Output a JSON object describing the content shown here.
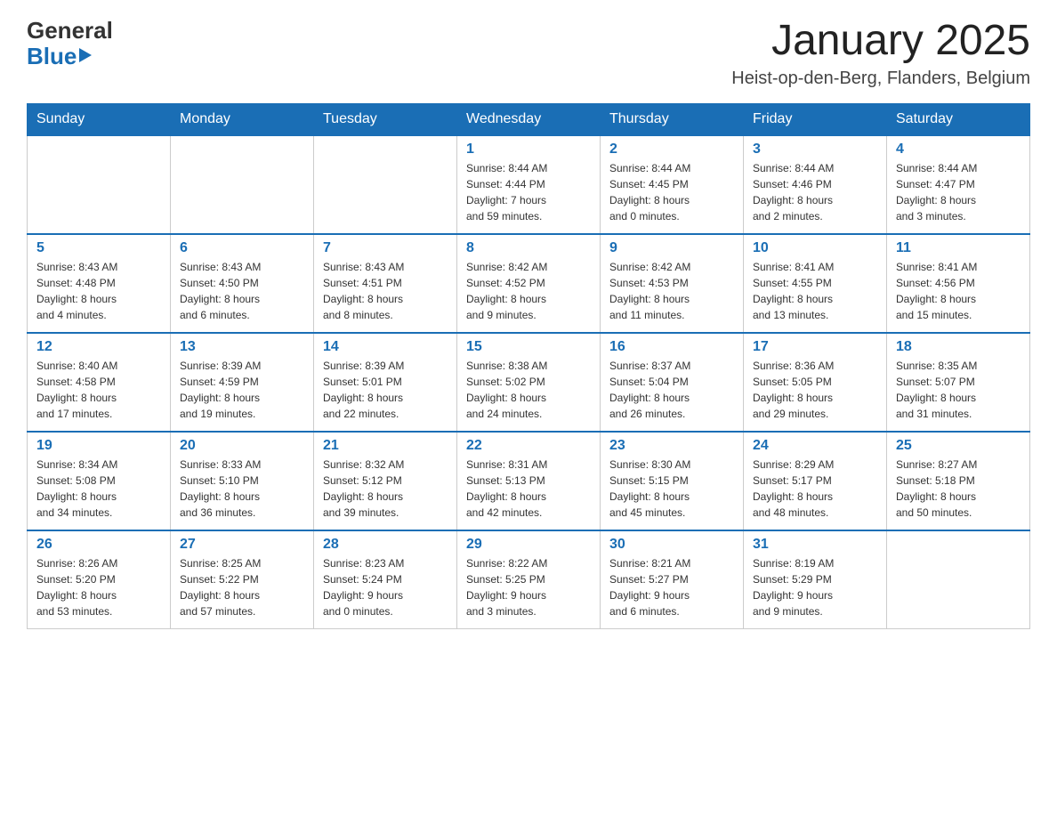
{
  "header": {
    "logo": {
      "general": "General",
      "blue": "Blue"
    },
    "title": "January 2025",
    "location": "Heist-op-den-Berg, Flanders, Belgium"
  },
  "days_of_week": [
    "Sunday",
    "Monday",
    "Tuesday",
    "Wednesday",
    "Thursday",
    "Friday",
    "Saturday"
  ],
  "weeks": [
    {
      "days": [
        {
          "date": "",
          "info": ""
        },
        {
          "date": "",
          "info": ""
        },
        {
          "date": "",
          "info": ""
        },
        {
          "date": "1",
          "info": "Sunrise: 8:44 AM\nSunset: 4:44 PM\nDaylight: 7 hours\nand 59 minutes."
        },
        {
          "date": "2",
          "info": "Sunrise: 8:44 AM\nSunset: 4:45 PM\nDaylight: 8 hours\nand 0 minutes."
        },
        {
          "date": "3",
          "info": "Sunrise: 8:44 AM\nSunset: 4:46 PM\nDaylight: 8 hours\nand 2 minutes."
        },
        {
          "date": "4",
          "info": "Sunrise: 8:44 AM\nSunset: 4:47 PM\nDaylight: 8 hours\nand 3 minutes."
        }
      ]
    },
    {
      "days": [
        {
          "date": "5",
          "info": "Sunrise: 8:43 AM\nSunset: 4:48 PM\nDaylight: 8 hours\nand 4 minutes."
        },
        {
          "date": "6",
          "info": "Sunrise: 8:43 AM\nSunset: 4:50 PM\nDaylight: 8 hours\nand 6 minutes."
        },
        {
          "date": "7",
          "info": "Sunrise: 8:43 AM\nSunset: 4:51 PM\nDaylight: 8 hours\nand 8 minutes."
        },
        {
          "date": "8",
          "info": "Sunrise: 8:42 AM\nSunset: 4:52 PM\nDaylight: 8 hours\nand 9 minutes."
        },
        {
          "date": "9",
          "info": "Sunrise: 8:42 AM\nSunset: 4:53 PM\nDaylight: 8 hours\nand 11 minutes."
        },
        {
          "date": "10",
          "info": "Sunrise: 8:41 AM\nSunset: 4:55 PM\nDaylight: 8 hours\nand 13 minutes."
        },
        {
          "date": "11",
          "info": "Sunrise: 8:41 AM\nSunset: 4:56 PM\nDaylight: 8 hours\nand 15 minutes."
        }
      ]
    },
    {
      "days": [
        {
          "date": "12",
          "info": "Sunrise: 8:40 AM\nSunset: 4:58 PM\nDaylight: 8 hours\nand 17 minutes."
        },
        {
          "date": "13",
          "info": "Sunrise: 8:39 AM\nSunset: 4:59 PM\nDaylight: 8 hours\nand 19 minutes."
        },
        {
          "date": "14",
          "info": "Sunrise: 8:39 AM\nSunset: 5:01 PM\nDaylight: 8 hours\nand 22 minutes."
        },
        {
          "date": "15",
          "info": "Sunrise: 8:38 AM\nSunset: 5:02 PM\nDaylight: 8 hours\nand 24 minutes."
        },
        {
          "date": "16",
          "info": "Sunrise: 8:37 AM\nSunset: 5:04 PM\nDaylight: 8 hours\nand 26 minutes."
        },
        {
          "date": "17",
          "info": "Sunrise: 8:36 AM\nSunset: 5:05 PM\nDaylight: 8 hours\nand 29 minutes."
        },
        {
          "date": "18",
          "info": "Sunrise: 8:35 AM\nSunset: 5:07 PM\nDaylight: 8 hours\nand 31 minutes."
        }
      ]
    },
    {
      "days": [
        {
          "date": "19",
          "info": "Sunrise: 8:34 AM\nSunset: 5:08 PM\nDaylight: 8 hours\nand 34 minutes."
        },
        {
          "date": "20",
          "info": "Sunrise: 8:33 AM\nSunset: 5:10 PM\nDaylight: 8 hours\nand 36 minutes."
        },
        {
          "date": "21",
          "info": "Sunrise: 8:32 AM\nSunset: 5:12 PM\nDaylight: 8 hours\nand 39 minutes."
        },
        {
          "date": "22",
          "info": "Sunrise: 8:31 AM\nSunset: 5:13 PM\nDaylight: 8 hours\nand 42 minutes."
        },
        {
          "date": "23",
          "info": "Sunrise: 8:30 AM\nSunset: 5:15 PM\nDaylight: 8 hours\nand 45 minutes."
        },
        {
          "date": "24",
          "info": "Sunrise: 8:29 AM\nSunset: 5:17 PM\nDaylight: 8 hours\nand 48 minutes."
        },
        {
          "date": "25",
          "info": "Sunrise: 8:27 AM\nSunset: 5:18 PM\nDaylight: 8 hours\nand 50 minutes."
        }
      ]
    },
    {
      "days": [
        {
          "date": "26",
          "info": "Sunrise: 8:26 AM\nSunset: 5:20 PM\nDaylight: 8 hours\nand 53 minutes."
        },
        {
          "date": "27",
          "info": "Sunrise: 8:25 AM\nSunset: 5:22 PM\nDaylight: 8 hours\nand 57 minutes."
        },
        {
          "date": "28",
          "info": "Sunrise: 8:23 AM\nSunset: 5:24 PM\nDaylight: 9 hours\nand 0 minutes."
        },
        {
          "date": "29",
          "info": "Sunrise: 8:22 AM\nSunset: 5:25 PM\nDaylight: 9 hours\nand 3 minutes."
        },
        {
          "date": "30",
          "info": "Sunrise: 8:21 AM\nSunset: 5:27 PM\nDaylight: 9 hours\nand 6 minutes."
        },
        {
          "date": "31",
          "info": "Sunrise: 8:19 AM\nSunset: 5:29 PM\nDaylight: 9 hours\nand 9 minutes."
        },
        {
          "date": "",
          "info": ""
        }
      ]
    }
  ]
}
